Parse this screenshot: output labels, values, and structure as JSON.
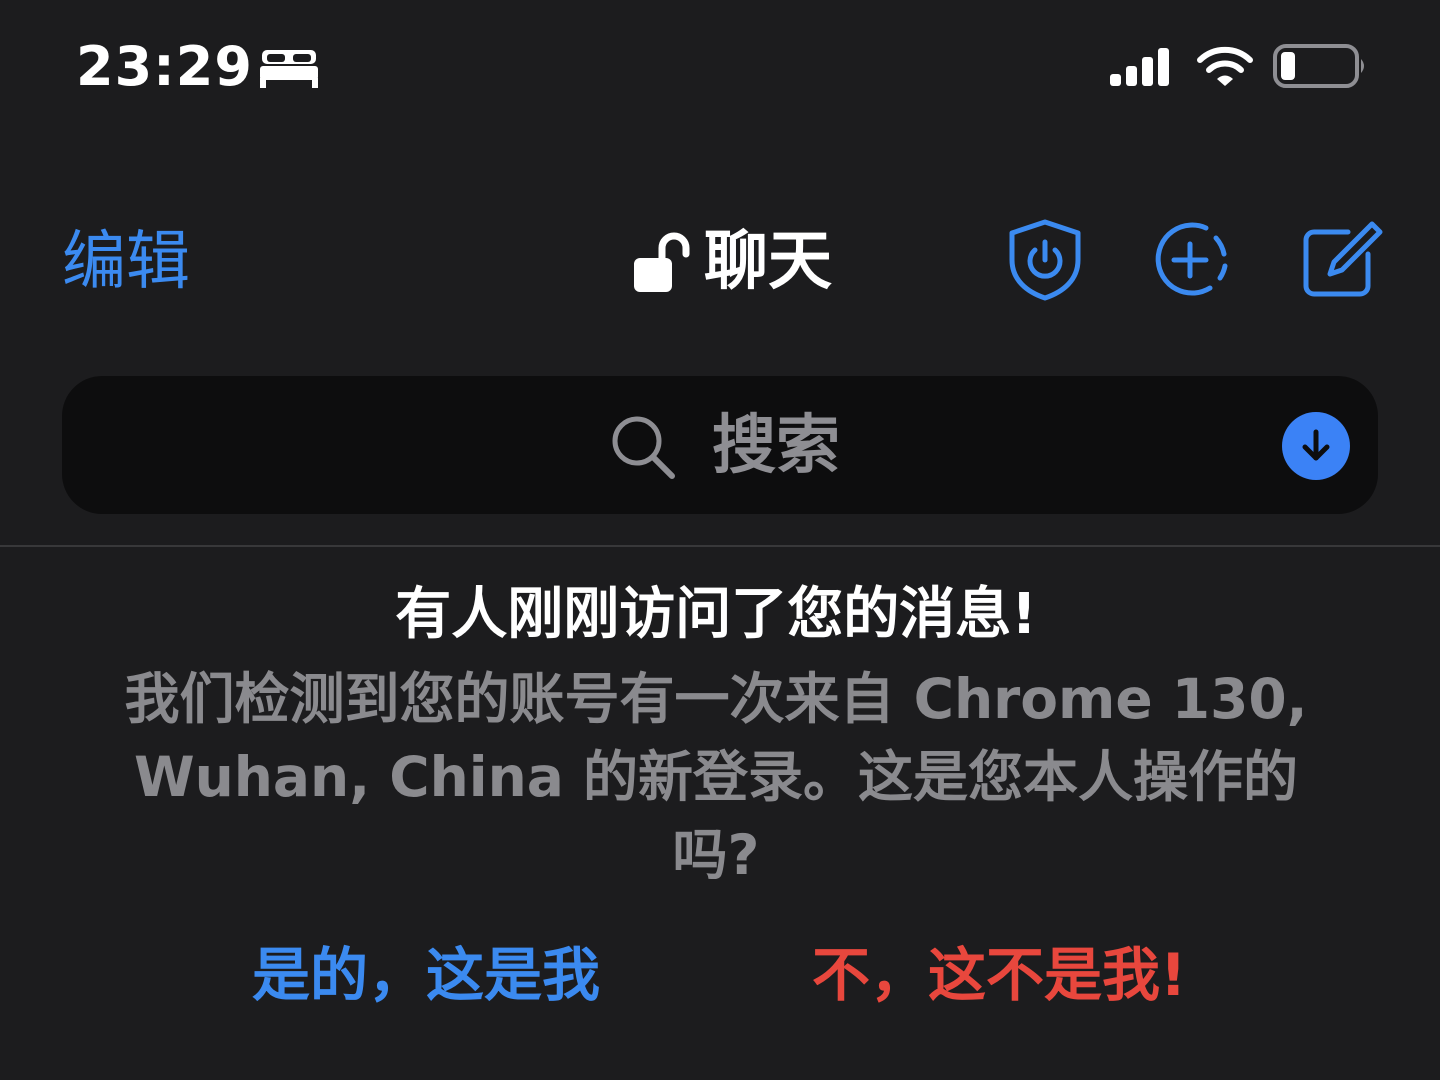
{
  "status_bar": {
    "time": "23:29",
    "sleep_icon": "bed-icon",
    "signal_icon": "cellular-signal-icon",
    "wifi_icon": "wifi-icon",
    "battery_icon": "battery-low-icon",
    "battery_level": 0.2
  },
  "nav": {
    "edit_label": "编辑",
    "title": "聊天",
    "lock_icon": "unlocked-padlock-icon",
    "shield_icon": "shield-power-icon",
    "story_icon": "add-story-icon",
    "compose_icon": "compose-icon"
  },
  "search": {
    "placeholder": "搜索",
    "search_icon": "magnifier-icon",
    "download_icon": "arrow-down-circle-icon"
  },
  "alert": {
    "title": "有人刚刚访问了您的消息!",
    "body": "我们检测到您的账号有一次来自 Chrome 130, Wuhan, China 的新登录。这是您本人操作的吗?",
    "confirm_label": "是的，这是我",
    "deny_label": "不，这不是我!"
  },
  "colors": {
    "background": "#1c1c1e",
    "accent": "#3b8af0",
    "danger": "#e8473d",
    "muted_text": "#8a8a8e",
    "search_background": "#0d0d0e"
  }
}
